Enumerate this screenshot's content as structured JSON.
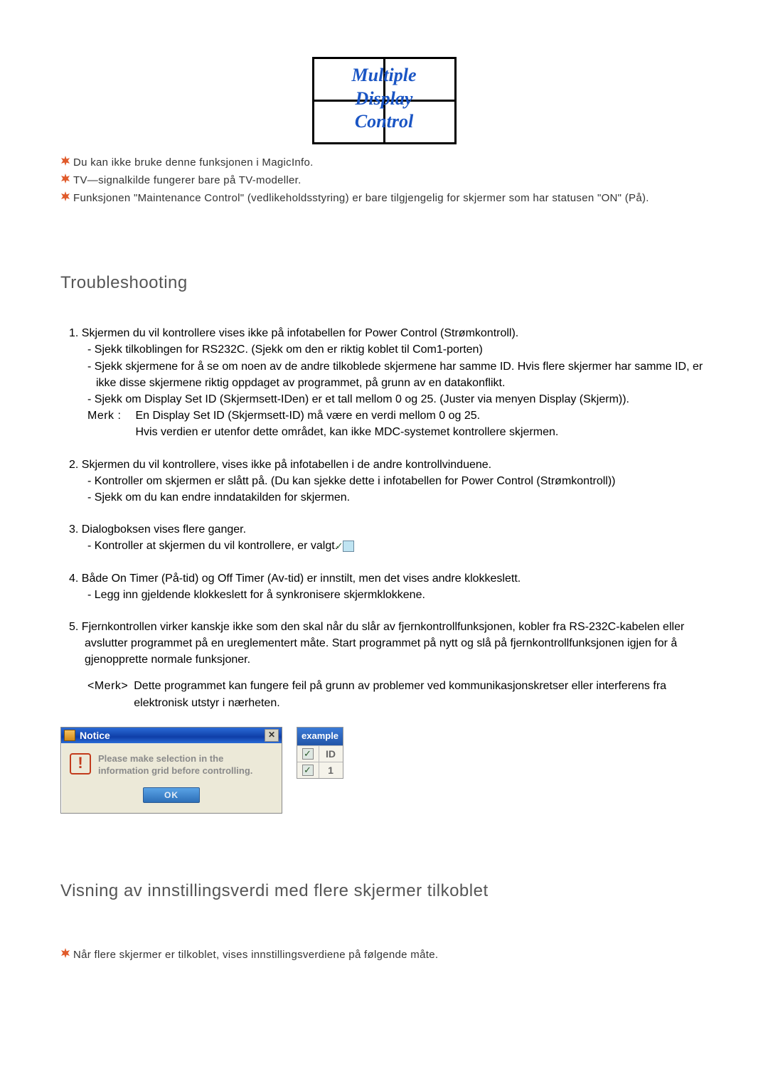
{
  "logo": {
    "line1": "Multiple",
    "line2": "Display",
    "line3": "Control"
  },
  "top_notes": [
    "Du kan ikke bruke denne funksjonen i MagicInfo.",
    "TV—signalkilde fungerer bare på TV-modeller.",
    "Funksjonen \"Maintenance Control\" (vedlikeholdsstyring) er bare tilgjengelig for skjermer som har statusen \"ON\" (På)."
  ],
  "section1": "Troubleshooting",
  "items": {
    "i1": {
      "head": "1.  Skjermen du vil kontrollere vises ikke på infotabellen for Power Control (Strømkontroll).",
      "sub1": "- Sjekk tilkoblingen for RS232C. (Sjekk om den er riktig koblet til Com1-porten)",
      "sub2": "- Sjekk skjermene for å se om noen av de andre tilkoblede skjermene har samme ID. Hvis flere skjermer har samme ID, er ikke disse skjermene riktig oppdaget av programmet, på grunn av en datakonflikt.",
      "sub3": "- Sjekk om Display Set ID (Skjermsett-IDen) er et tall mellom 0 og 25. (Juster via menyen Display (Skjerm)).",
      "merk_label": "Merk :",
      "merk_body1": "En Display Set ID (Skjermsett-ID) må være en verdi mellom 0 og 25.",
      "merk_body2": "Hvis verdien er utenfor dette området, kan ikke MDC-systemet kontrollere skjermen."
    },
    "i2": {
      "head": "2.  Skjermen du vil kontrollere, vises ikke på infotabellen i de andre kontrollvinduene.",
      "sub1": "- Kontroller om skjermen er slått på. (Du kan sjekke dette i infotabellen for Power Control (Strømkontroll))",
      "sub2": "- Sjekk om du kan endre inndatakilden for skjermen."
    },
    "i3": {
      "head": "3.  Dialogboksen vises flere ganger.",
      "sub1": "- Kontroller at skjermen du vil kontrollere, er valgt."
    },
    "i4": {
      "head": "4.  Både On Timer (På-tid) og Off Timer (Av-tid) er innstilt, men det vises andre klokkeslett.",
      "sub1": "- Legg inn gjeldende klokkeslett for å synkronisere skjermklokkene."
    },
    "i5": {
      "head": "5.  Fjernkontrollen virker kanskje ikke som den skal når du slår av fjernkontrollfunksjonen, kobler fra RS-232C-kabelen eller avslutter programmet på en ureglementert måte. Start programmet på nytt og slå på fjernkontrollfunksjonen igjen for å gjenopprette normale funksjoner.",
      "note_label": "<Merk>",
      "note_body": "Dette programmet kan fungere feil på grunn av problemer ved kommunikasjonskretser eller interferens fra elektronisk utstyr i nærheten."
    }
  },
  "dialog": {
    "title": "Notice",
    "msg1": "Please make selection in the",
    "msg2": "information grid before controlling.",
    "ok": "OK"
  },
  "example": {
    "head": "example",
    "col": "ID",
    "val": "1"
  },
  "section2": "Visning av innstillingsverdi med flere skjermer tilkoblet",
  "bottom_note": "Når flere skjermer er tilkoblet, vises innstillingsverdiene på følgende måte."
}
